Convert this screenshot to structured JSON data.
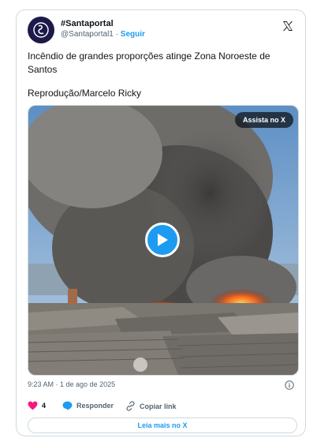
{
  "account": {
    "display_name": "#Santaportal",
    "handle": "@Santaportal1",
    "separator": "·",
    "follow_label": "Seguir"
  },
  "tweet": {
    "text": "Incêndio de grandes proporções atinge Zona Noroeste de\nSantos",
    "credit": "Reprodução/Marcelo Ricky",
    "timestamp": "9:23 AM · 1 de ago de 2025"
  },
  "media": {
    "watch_label": "Assista no X"
  },
  "actions": {
    "like_count": "4",
    "reply_label": "Responder",
    "copy_label": "Copiar link"
  },
  "read_more_label": "Leia mais no X",
  "colors": {
    "accent": "#1d9bf0",
    "like": "#f91880",
    "border": "#cfd9de",
    "muted": "#536471"
  }
}
